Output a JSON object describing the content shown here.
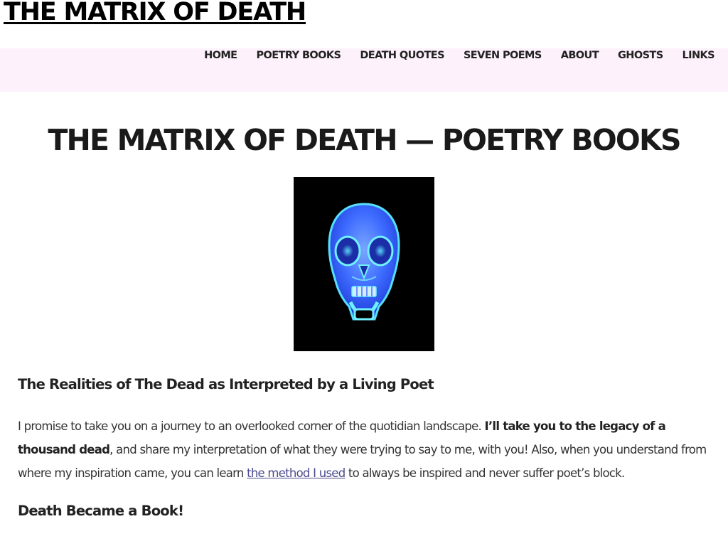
{
  "site": {
    "title": "THE MATRIX OF DEATH"
  },
  "nav": {
    "items": [
      {
        "label": "HOME"
      },
      {
        "label": "POETRY BOOKS"
      },
      {
        "label": "DEATH QUOTES"
      },
      {
        "label": "SEVEN POEMS"
      },
      {
        "label": "ABOUT"
      },
      {
        "label": "GHOSTS"
      },
      {
        "label": "LINKS"
      }
    ]
  },
  "page": {
    "title": "THE MATRIX OF DEATH — POETRY BOOKS",
    "image": {
      "name": "crystal-skull-image"
    },
    "subheading": "The Realities of The Dead as Interpreted by a Living Poet",
    "intro": {
      "part1": "I promise to take you on a journey to an overlooked corner of the quotidian landscape. ",
      "bold": "I’ll take you to the legacy of a thousand dead",
      "part2": ", and share my interpretation of what they were trying to say to me, with you! Also, when you understand from where my inspiration came, you can learn ",
      "link": "the method I used",
      "part3": " to always be inspired and never suffer poet’s block."
    },
    "subheading2": "Death Became a Book!"
  },
  "colors": {
    "nav_background": "#fdf2fc",
    "link": "#4b4a8c",
    "skull_background": "#000000",
    "skull_glow": "#5fd3ff"
  }
}
